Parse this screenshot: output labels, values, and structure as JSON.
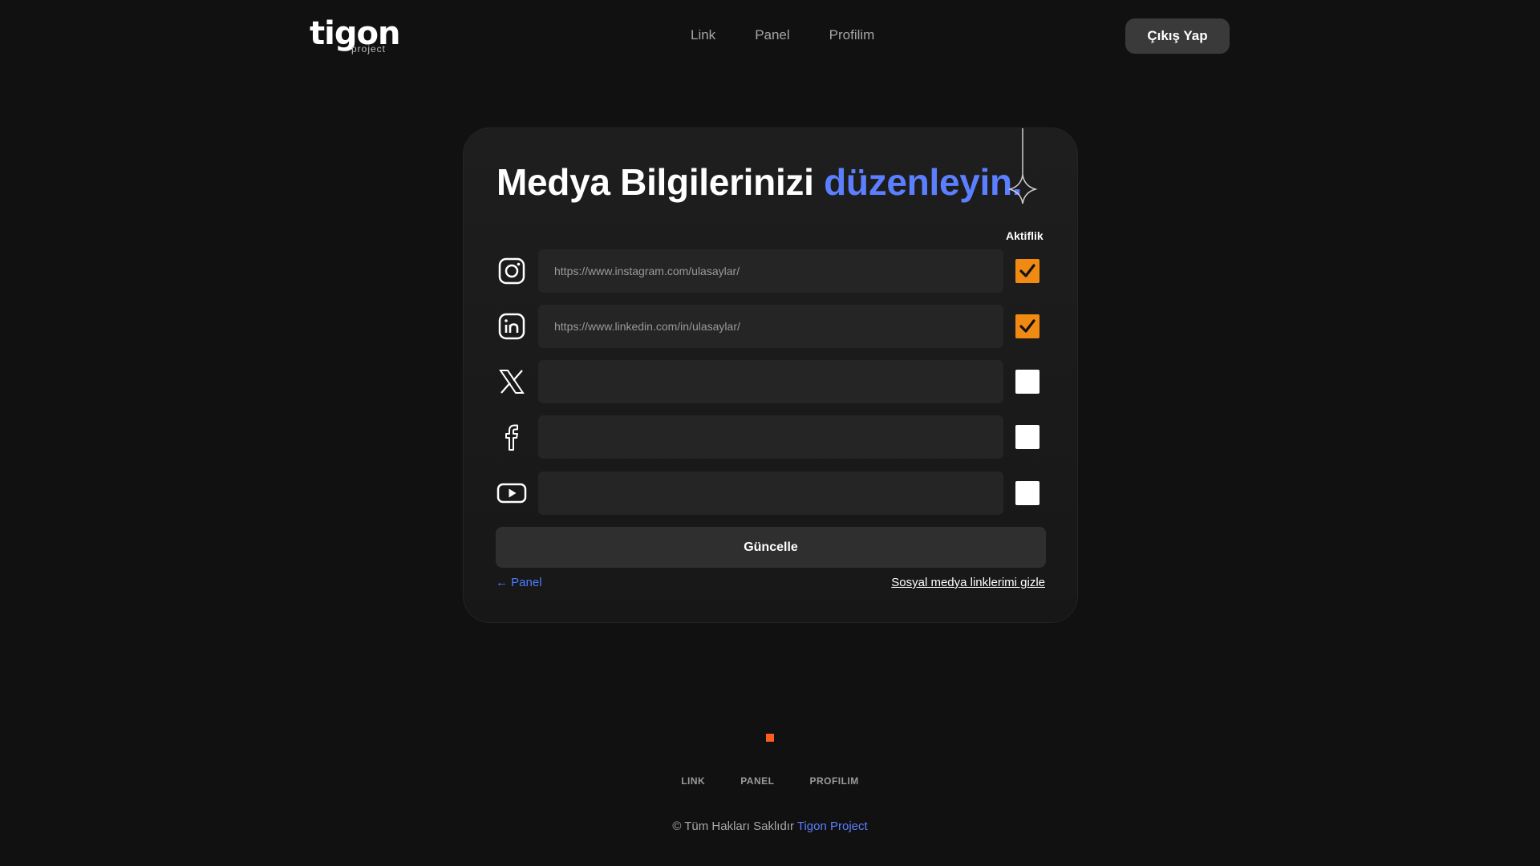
{
  "brand": {
    "logo_text": "tigon",
    "logo_sub": "project"
  },
  "nav": {
    "items": [
      "Link",
      "Panel",
      "Profilim"
    ],
    "logout_label": "Çıkış Yap"
  },
  "card": {
    "title_main": "Medya Bilgilerinizi ",
    "title_accent": "düzenleyin.",
    "active_column_label": "Aktiflik",
    "rows": [
      {
        "icon": "instagram-icon",
        "value": "https://www.instagram.com/ulasaylar/",
        "active": true
      },
      {
        "icon": "linkedin-icon",
        "value": "https://www.linkedin.com/in/ulasaylar/",
        "active": true
      },
      {
        "icon": "x-twitter-icon",
        "value": "",
        "active": false
      },
      {
        "icon": "facebook-icon",
        "value": "",
        "active": false
      },
      {
        "icon": "youtube-icon",
        "value": "",
        "active": false
      }
    ],
    "submit_label": "Güncelle",
    "back_label": "← Panel",
    "hide_label": "Sosyal medya linklerimi gizle"
  },
  "footer": {
    "nav": [
      "LINK",
      "PANEL",
      "PROFILIM"
    ],
    "copyright_prefix": "© Tüm Hakları Saklıdır ",
    "copyright_brand": "Tigon Project"
  },
  "colors": {
    "accent": "#5b7fff",
    "checkbox_on": "#f08a12",
    "dot": "#ff5a1f"
  }
}
